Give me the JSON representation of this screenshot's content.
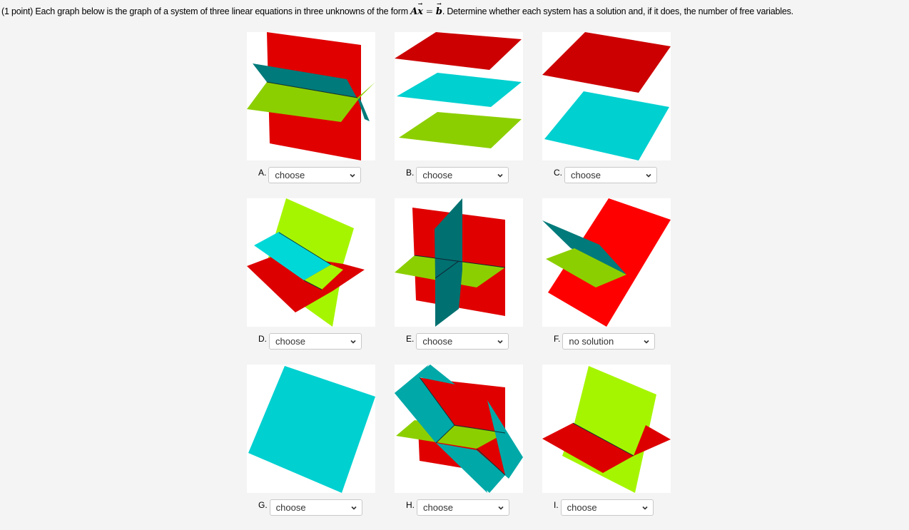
{
  "prompt": {
    "prefix": "(1 point) Each graph below is the graph of a system of three linear equations in three unknowns of the form ",
    "matrix_symbol": "A",
    "vector_x": "x",
    "equals": "=",
    "vector_b": "b",
    "suffix": ". Determine whether each system has a solution and, if it does, the number of free variables."
  },
  "colors": {
    "red": "#e00000",
    "dark_red": "#cc0000",
    "bright_red": "#ff0000",
    "teal": "#007a7a",
    "cyan": "#00d0d0",
    "cyan_dark": "#00a8a8",
    "green": "#8ccf00",
    "lime": "#a6f500"
  },
  "graphs": [
    {
      "label": "A.",
      "selected": "choose",
      "description": "three planes intersecting in a common line"
    },
    {
      "label": "B.",
      "selected": "choose",
      "description": "three parallel planes"
    },
    {
      "label": "C.",
      "selected": "choose",
      "description": "two parallel planes"
    },
    {
      "label": "D.",
      "selected": "choose",
      "description": "two parallel planes cut by a third plane"
    },
    {
      "label": "E.",
      "selected": "choose",
      "description": "three planes intersecting in a single point"
    },
    {
      "label": "F.",
      "selected": "no solution",
      "description": "three planes intersecting in a common line"
    },
    {
      "label": "G.",
      "selected": "choose",
      "description": "single plane (coincident planes)"
    },
    {
      "label": "H.",
      "selected": "choose",
      "description": "three planes intersecting in a single point"
    },
    {
      "label": "I.",
      "selected": "choose",
      "description": "two planes intersecting in a line"
    }
  ]
}
